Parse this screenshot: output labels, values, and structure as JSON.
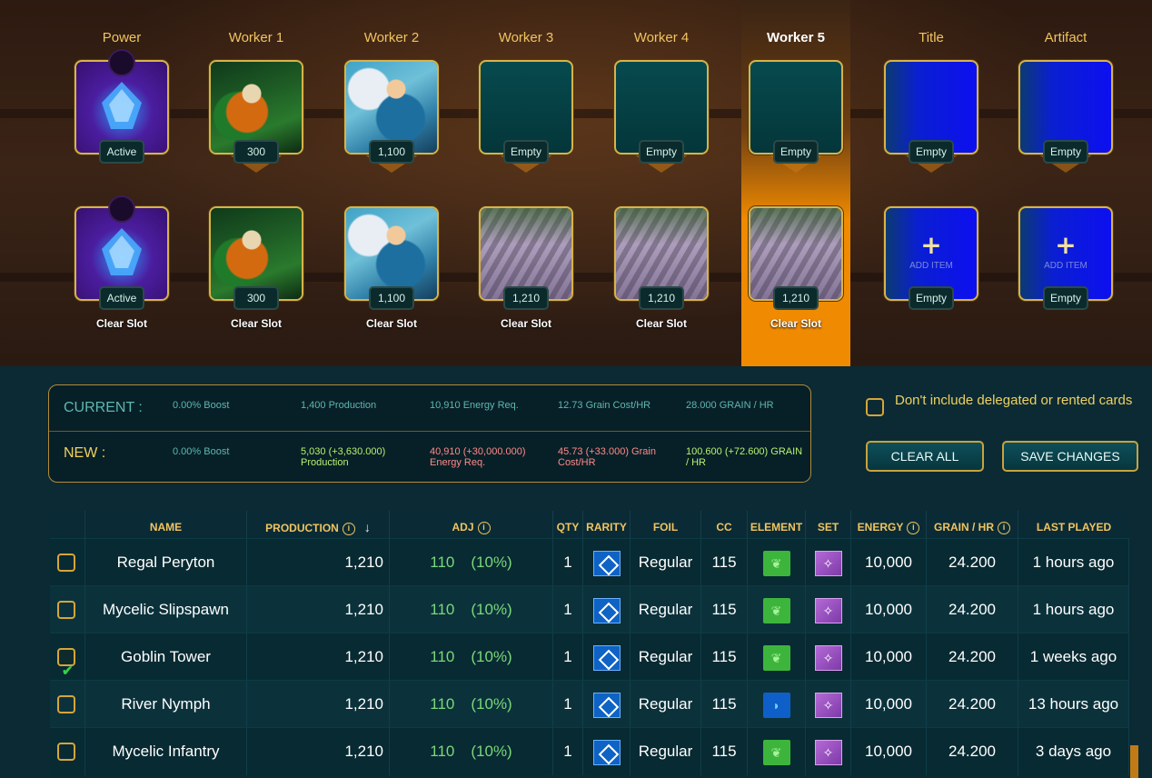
{
  "columns": [
    {
      "header": "Power",
      "selected": false
    },
    {
      "header": "Worker 1",
      "selected": false
    },
    {
      "header": "Worker 2",
      "selected": false
    },
    {
      "header": "Worker 3",
      "selected": false
    },
    {
      "header": "Worker 4",
      "selected": false
    },
    {
      "header": "Worker 5",
      "selected": true
    },
    {
      "header": "Title",
      "selected": false
    },
    {
      "header": "Artifact",
      "selected": false
    }
  ],
  "current_slots": [
    {
      "art": "power",
      "badge": "Active"
    },
    {
      "art": "plant",
      "badge": "300"
    },
    {
      "art": "angel",
      "badge": "1,100"
    },
    {
      "art": "empty",
      "badge": "Empty"
    },
    {
      "art": "empty",
      "badge": "Empty"
    },
    {
      "art": "empty",
      "badge": "Empty"
    },
    {
      "art": "blue",
      "badge": "Empty"
    },
    {
      "art": "blue",
      "badge": "Empty"
    }
  ],
  "new_slots": [
    {
      "art": "power",
      "badge": "Active",
      "clear": "Clear Slot"
    },
    {
      "art": "plant",
      "badge": "300",
      "clear": "Clear Slot"
    },
    {
      "art": "angel",
      "badge": "1,100",
      "clear": "Clear Slot"
    },
    {
      "art": "tower",
      "badge": "1,210",
      "clear": "Clear Slot"
    },
    {
      "art": "tower",
      "badge": "1,210",
      "clear": "Clear Slot"
    },
    {
      "art": "tower",
      "badge": "1,210",
      "clear": "Clear Slot"
    },
    {
      "art": "add",
      "badge": "Empty",
      "add_label": "ADD ITEM",
      "plus": "+"
    },
    {
      "art": "add",
      "badge": "Empty",
      "add_label": "ADD ITEM",
      "plus": "+"
    }
  ],
  "stats": {
    "current_label": "CURRENT :",
    "new_label": "NEW :",
    "current": [
      "0.00% Boost",
      "1,400 Production",
      "10,910 Energy Req.",
      "12.73 Grain Cost/HR",
      "28.000 GRAIN / HR"
    ],
    "new": [
      "0.00% Boost",
      "5,030 (+3,630.000) Production",
      "40,910 (+30,000.000) Energy Req.",
      "45.73 (+33.000) Grain Cost/HR",
      "100.600 (+72.600) GRAIN / HR"
    ]
  },
  "options": {
    "exclude_delegated_label": "Don't include delegated or rented cards",
    "exclude_delegated_checked": false,
    "clear_all_label": "CLEAR ALL",
    "save_changes_label": "SAVE CHANGES"
  },
  "table": {
    "headers": {
      "name": "NAME",
      "production": "PRODUCTION",
      "sort_arrow": "↓",
      "adj": "ADJ",
      "qty": "QTY",
      "rarity": "RARITY",
      "foil": "FOIL",
      "cc": "CC",
      "element": "ELEMENT",
      "set": "SET",
      "energy": "ENERGY",
      "grain_hr": "GRAIN / HR",
      "last_played": "LAST PLAYED"
    },
    "rows": [
      {
        "checked": false,
        "name": "Regal Peryton",
        "production": "1,210",
        "adj_value": "110",
        "adj_pct": "(10%)",
        "qty": "1",
        "foil": "Regular",
        "cc": "115",
        "element": "earth",
        "energy": "10,000",
        "grain_hr": "24.200",
        "last_played": "1 hours ago"
      },
      {
        "checked": false,
        "name": "Mycelic Slipspawn",
        "production": "1,210",
        "adj_value": "110",
        "adj_pct": "(10%)",
        "qty": "1",
        "foil": "Regular",
        "cc": "115",
        "element": "earth",
        "energy": "10,000",
        "grain_hr": "24.200",
        "last_played": "1 hours ago"
      },
      {
        "checked": true,
        "name": "Goblin Tower",
        "production": "1,210",
        "adj_value": "110",
        "adj_pct": "(10%)",
        "qty": "1",
        "foil": "Regular",
        "cc": "115",
        "element": "earth",
        "energy": "10,000",
        "grain_hr": "24.200",
        "last_played": "1 weeks ago"
      },
      {
        "checked": false,
        "name": "River Nymph",
        "production": "1,210",
        "adj_value": "110",
        "adj_pct": "(10%)",
        "qty": "1",
        "foil": "Regular",
        "cc": "115",
        "element": "water",
        "energy": "10,000",
        "grain_hr": "24.200",
        "last_played": "13 hours ago"
      },
      {
        "checked": false,
        "name": "Mycelic Infantry",
        "production": "1,210",
        "adj_value": "110",
        "adj_pct": "(10%)",
        "qty": "1",
        "foil": "Regular",
        "cc": "115",
        "element": "earth",
        "energy": "10,000",
        "grain_hr": "24.200",
        "last_played": "3 days ago"
      }
    ]
  },
  "colors": {
    "accent_gold": "#f0c460",
    "selected_column": "#f08a00",
    "positive_green": "#7ad87a",
    "negative_red": "#ff8a8a"
  }
}
